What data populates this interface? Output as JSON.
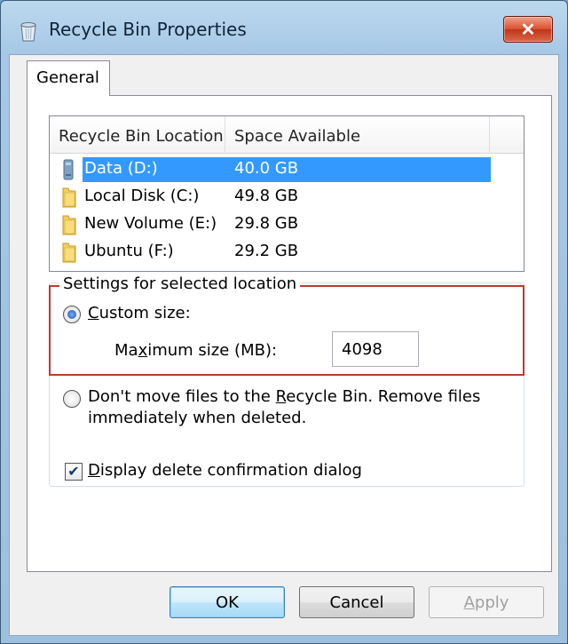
{
  "window": {
    "title": "Recycle Bin Properties",
    "close_label": "✕"
  },
  "tabs": [
    {
      "label": "General",
      "selected": true
    }
  ],
  "list": {
    "columns": [
      "Recycle Bin Location",
      "Space Available"
    ],
    "rows": [
      {
        "name": "Data (D:)",
        "space": "40.0 GB",
        "selected": true,
        "icon": "network-drive-icon"
      },
      {
        "name": "Local Disk (C:)",
        "space": "49.8 GB",
        "selected": false,
        "icon": "folder-icon"
      },
      {
        "name": "New Volume (E:)",
        "space": "29.8 GB",
        "selected": false,
        "icon": "folder-icon"
      },
      {
        "name": "Ubuntu (F:)",
        "space": "29.2 GB",
        "selected": false,
        "icon": "folder-icon"
      }
    ]
  },
  "settings": {
    "group_title": "Settings for selected location",
    "custom_size": {
      "pre": "",
      "accel": "C",
      "post": "ustom size:",
      "checked": true
    },
    "max_size": {
      "pre": "Ma",
      "accel": "x",
      "post": "imum size (MB):"
    },
    "max_size_value": "4098",
    "dont_move": {
      "line1_pre": "Don't move files to the ",
      "accel": "R",
      "line1_post": "ecycle Bin. Remove files",
      "line2": "immediately when deleted.",
      "checked": false
    }
  },
  "confirm": {
    "pre": "",
    "accel": "D",
    "post": "isplay delete confirmation dialog",
    "checked": true,
    "check_glyph": "✔"
  },
  "buttons": {
    "ok": "OK",
    "cancel": "Cancel",
    "apply_accel": "A",
    "apply_rest": "pply"
  },
  "colors": {
    "selection": "#3399ff",
    "highlight_box": "#c0392b"
  }
}
